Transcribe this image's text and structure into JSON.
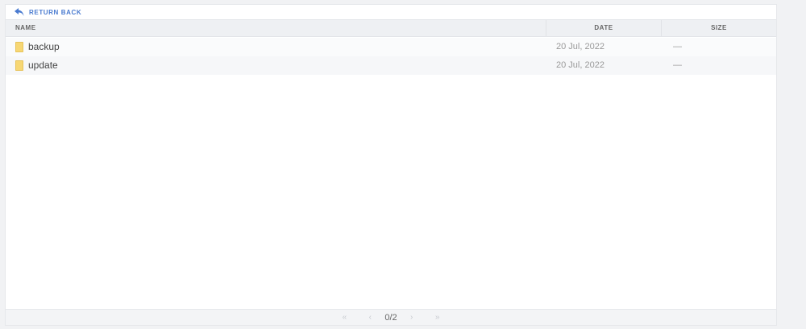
{
  "toolbar": {
    "return_label": "RETURN BACK"
  },
  "table": {
    "columns": [
      "NAME",
      "DATE",
      "SIZE"
    ],
    "rows": [
      {
        "name": "backup",
        "date": "20 Jul, 2022",
        "size": "—"
      },
      {
        "name": "update",
        "date": "20 Jul, 2022",
        "size": "—"
      }
    ]
  },
  "pagination": {
    "first": "«",
    "prev": "‹",
    "info": "0/2",
    "next": "›",
    "last": "»"
  },
  "colors": {
    "accent": "#4a7bd0",
    "folder": "#f7d774"
  },
  "icons": {
    "return": "return-back-arrow-icon",
    "folder": "folder-icon"
  }
}
